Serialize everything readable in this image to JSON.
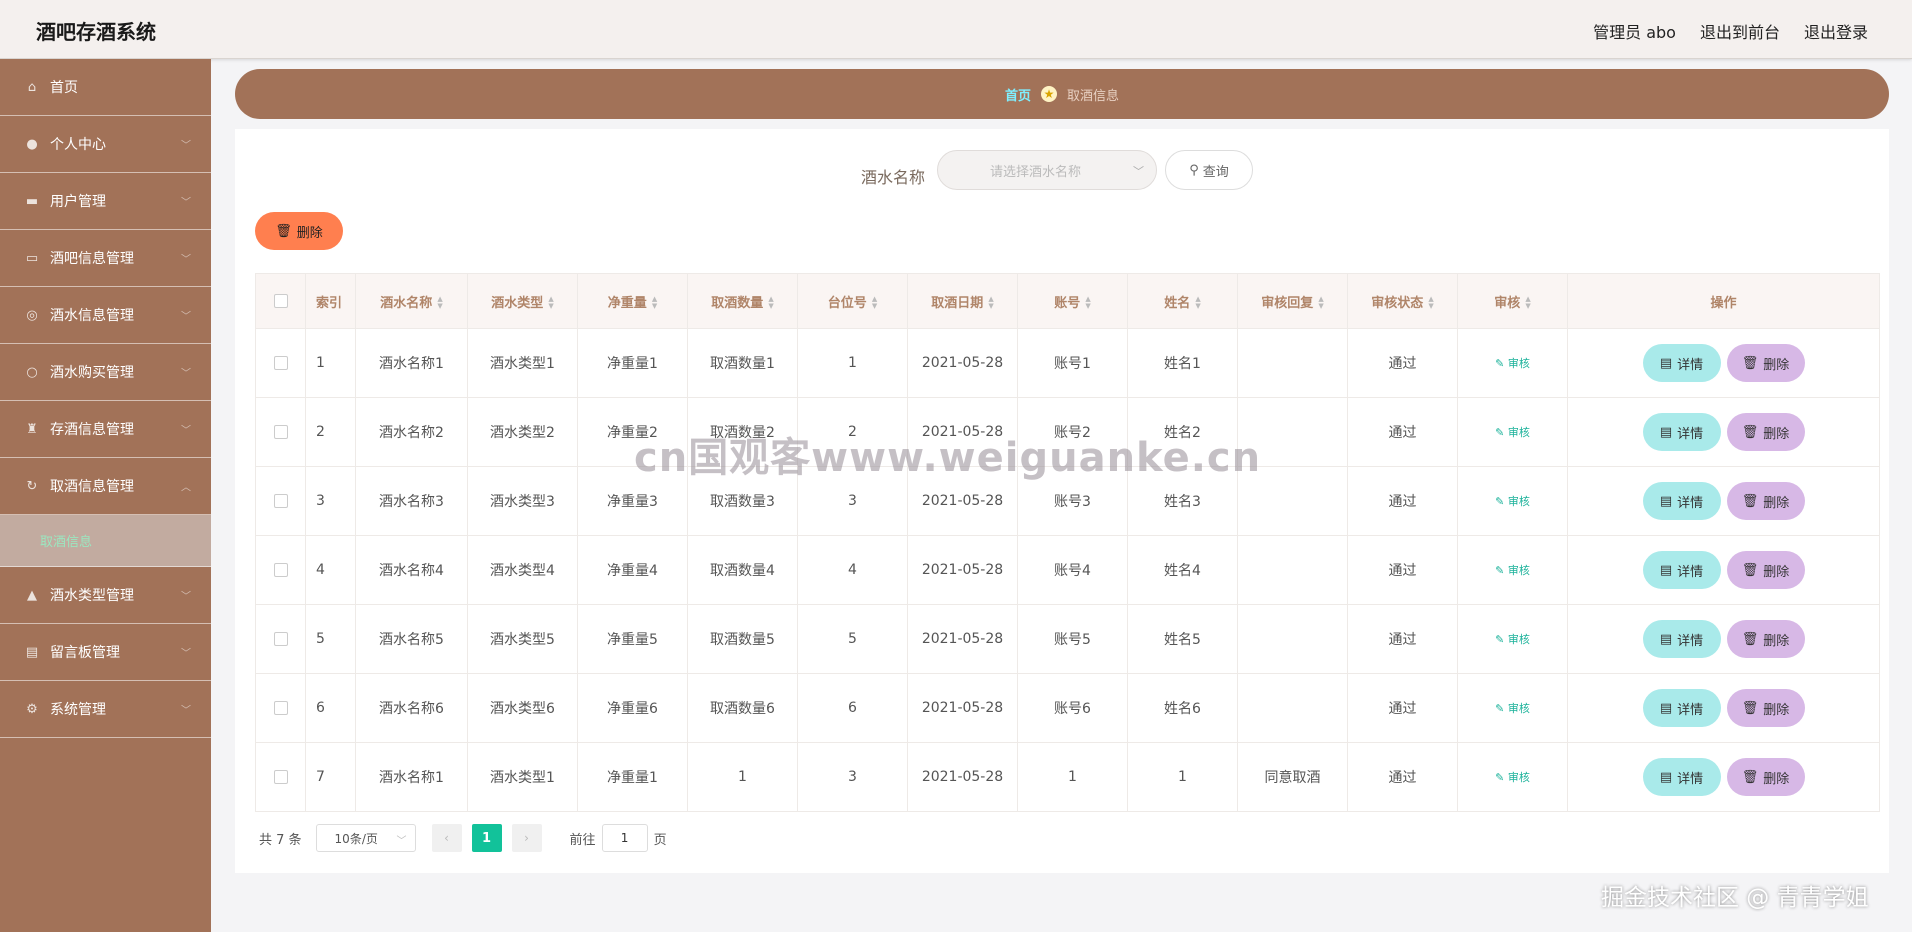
{
  "header": {
    "title": "酒吧存酒系统",
    "admin_label": "管理员 abo",
    "to_front": "退出到前台",
    "logout": "退出登录"
  },
  "sidebar": {
    "items": [
      {
        "label": "首页",
        "icon": "home-icon"
      },
      {
        "label": "个人中心",
        "icon": "user-icon"
      },
      {
        "label": "用户管理",
        "icon": "briefcase-icon"
      },
      {
        "label": "酒吧信息管理",
        "icon": "card-icon"
      },
      {
        "label": "酒水信息管理",
        "icon": "globe-icon"
      },
      {
        "label": "酒水购买管理",
        "icon": "circle-icon"
      },
      {
        "label": "存酒信息管理",
        "icon": "stamp-icon"
      },
      {
        "label": "取酒信息管理",
        "icon": "refresh-icon"
      },
      {
        "label": "酒水类型管理",
        "icon": "chart-icon"
      },
      {
        "label": "留言板管理",
        "icon": "message-icon"
      },
      {
        "label": "系统管理",
        "icon": "settings-icon"
      }
    ],
    "active_sub": "取酒信息"
  },
  "breadcrumb": {
    "home": "首页",
    "current": "取酒信息"
  },
  "search": {
    "label": "酒水名称",
    "placeholder": "请选择酒水名称",
    "button": "查询"
  },
  "toolbar": {
    "delete_label": "删除"
  },
  "table": {
    "columns": [
      "索引",
      "酒水名称",
      "酒水类型",
      "净重量",
      "取酒数量",
      "台位号",
      "取酒日期",
      "账号",
      "姓名",
      "审核回复",
      "审核状态",
      "审核",
      "操作"
    ],
    "audit_label": "审核",
    "detail_label": "详情",
    "delete_label": "删除",
    "rows": [
      [
        "1",
        "酒水名称1",
        "酒水类型1",
        "净重量1",
        "取酒数量1",
        "1",
        "2021-05-28",
        "账号1",
        "姓名1",
        "",
        "通过"
      ],
      [
        "2",
        "酒水名称2",
        "酒水类型2",
        "净重量2",
        "取酒数量2",
        "2",
        "2021-05-28",
        "账号2",
        "姓名2",
        "",
        "通过"
      ],
      [
        "3",
        "酒水名称3",
        "酒水类型3",
        "净重量3",
        "取酒数量3",
        "3",
        "2021-05-28",
        "账号3",
        "姓名3",
        "",
        "通过"
      ],
      [
        "4",
        "酒水名称4",
        "酒水类型4",
        "净重量4",
        "取酒数量4",
        "4",
        "2021-05-28",
        "账号4",
        "姓名4",
        "",
        "通过"
      ],
      [
        "5",
        "酒水名称5",
        "酒水类型5",
        "净重量5",
        "取酒数量5",
        "5",
        "2021-05-28",
        "账号5",
        "姓名5",
        "",
        "通过"
      ],
      [
        "6",
        "酒水名称6",
        "酒水类型6",
        "净重量6",
        "取酒数量6",
        "6",
        "2021-05-28",
        "账号6",
        "姓名6",
        "",
        "通过"
      ],
      [
        "7",
        "酒水名称1",
        "酒水类型1",
        "净重量1",
        "1",
        "3",
        "2021-05-28",
        "1",
        "1",
        "同意取酒",
        "通过"
      ]
    ]
  },
  "pagination": {
    "total": "共 7 条",
    "page_size": "10条/页",
    "current_page": "1",
    "goto_prefix": "前往",
    "goto_value": "1",
    "goto_suffix": "页"
  },
  "watermarks": {
    "center": "cn国观客www.weiguanke.cn",
    "corner": "掘金技术社区 @ 青青学姐"
  },
  "colors": {
    "sidebar_bg": "#a27258",
    "accent_green": "#12c29a",
    "delete_orange": "#ff7f4f",
    "detail_cyan": "#a9eaea",
    "row_delete_purple": "#d7b8e6"
  }
}
